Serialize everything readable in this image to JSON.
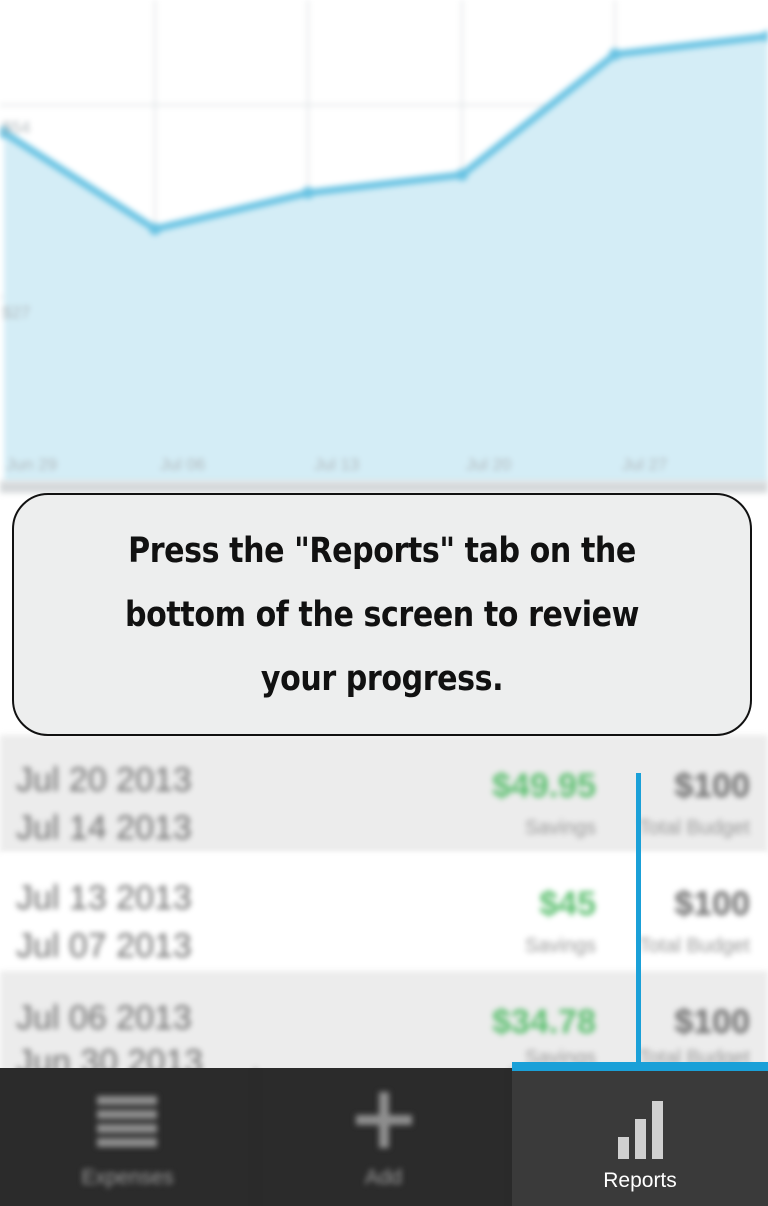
{
  "chart": {
    "y_labels": [
      "$54",
      "$27"
    ],
    "x_labels": [
      "Jun 29",
      "Jul 06",
      "Jul 13",
      "Jul 20",
      "Jul 27"
    ],
    "series": [
      58,
      42,
      48,
      51,
      71,
      74
    ],
    "line_color": "#69c3e3",
    "fill_color": "#d4edf6"
  },
  "rows": [
    {
      "date_start": "Jul 20 2013",
      "date_end": "Jul 14 2013",
      "savings": "$49.95",
      "budget": "$100",
      "savings_label": "Savings",
      "budget_label": "Total Budget"
    },
    {
      "date_start": "Jul 13 2013",
      "date_end": "Jul 07 2013",
      "savings": "$45",
      "budget": "$100",
      "savings_label": "Savings",
      "budget_label": "Total Budget"
    },
    {
      "date_start": "Jul 06 2013",
      "date_end": "Jun 30 2013",
      "savings": "$34.78",
      "budget": "$100",
      "savings_label": "Savings",
      "budget_label": "Total Budget"
    }
  ],
  "callout": {
    "text": "Press the \"Reports\" tab on the bottom of the screen to review your progress."
  },
  "tabs": {
    "expenses": {
      "label": "Expenses",
      "icon": "list-icon"
    },
    "add": {
      "label": "Add",
      "icon": "plus-icon"
    },
    "reports": {
      "label": "Reports",
      "icon": "bar-chart-icon"
    }
  },
  "colors": {
    "accent": "#1aa0d8",
    "savings_green": "#5bbf6f"
  }
}
